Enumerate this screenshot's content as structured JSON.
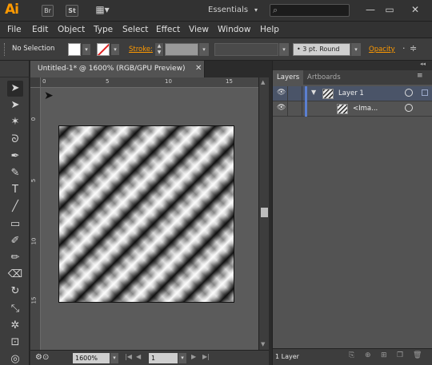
{
  "app": {
    "logo": "Ai",
    "workspace": "Essentials"
  },
  "titlebar": {
    "bridge_icon": "Br",
    "stock_icon": "St",
    "arrange_icon": "▦▾",
    "workspace_caret": "▾",
    "search_placeholder": "",
    "minimize": "—",
    "maximize": "▭",
    "close": "✕"
  },
  "menu": [
    "File",
    "Edit",
    "Object",
    "Type",
    "Select",
    "Effect",
    "View",
    "Window",
    "Help"
  ],
  "control": {
    "selection": "No Selection",
    "stroke_label": "Stroke:",
    "brush_definition": "3 pt. Round",
    "opacity_label": "Opacity",
    "fill_color": "#ffffff",
    "stroke_color": "none"
  },
  "document": {
    "tab_title": "Untitled-1* @ 1600% (RGB/GPU Preview)",
    "close_icon": "✕",
    "ruler_h": [
      "0",
      "5",
      "10",
      "15"
    ],
    "ruler_v": [
      "0",
      "5",
      "10",
      "15"
    ]
  },
  "status": {
    "zoom": "1600%",
    "artboard": "1",
    "first": "|◀",
    "prev": "◀",
    "next": "▶",
    "last": "▶|"
  },
  "tools": [
    {
      "name": "selection-tool-icon",
      "glyph": "➤",
      "active": true
    },
    {
      "name": "direct-selection-tool-icon",
      "glyph": "➤"
    },
    {
      "name": "magic-wand-tool-icon",
      "glyph": "✶"
    },
    {
      "name": "lasso-tool-icon",
      "glyph": "ᘐ"
    },
    {
      "name": "pen-tool-icon",
      "glyph": "✒"
    },
    {
      "name": "curvature-tool-icon",
      "glyph": "✎"
    },
    {
      "name": "type-tool-icon",
      "glyph": "T"
    },
    {
      "name": "line-segment-tool-icon",
      "glyph": "╱"
    },
    {
      "name": "rectangle-tool-icon",
      "glyph": "▭"
    },
    {
      "name": "paintbrush-tool-icon",
      "glyph": "✐"
    },
    {
      "name": "pencil-tool-icon",
      "glyph": "✏"
    },
    {
      "name": "eraser-tool-icon",
      "glyph": "⌫"
    },
    {
      "name": "rotate-tool-icon",
      "glyph": "↻"
    },
    {
      "name": "scale-tool-icon",
      "glyph": "⤡"
    },
    {
      "name": "puppet-warp-tool-icon",
      "glyph": "✲"
    },
    {
      "name": "free-transform-tool-icon",
      "glyph": "⊡"
    },
    {
      "name": "shape-builder-tool-icon",
      "glyph": "◎"
    }
  ],
  "layers_panel": {
    "tabs": [
      "Layers",
      "Artboards"
    ],
    "rows": [
      {
        "name": "Layer 1",
        "expanded": "▼",
        "selected": true,
        "color": "#5b7fd1"
      },
      {
        "name": "<Ima...",
        "selected": false
      }
    ],
    "count": "1 Layer",
    "collapse_icon": "◂◂",
    "menu_icon": "≡",
    "footer_icons": [
      "⎘",
      "⊕",
      "⊞",
      "❐",
      "🗑"
    ]
  }
}
